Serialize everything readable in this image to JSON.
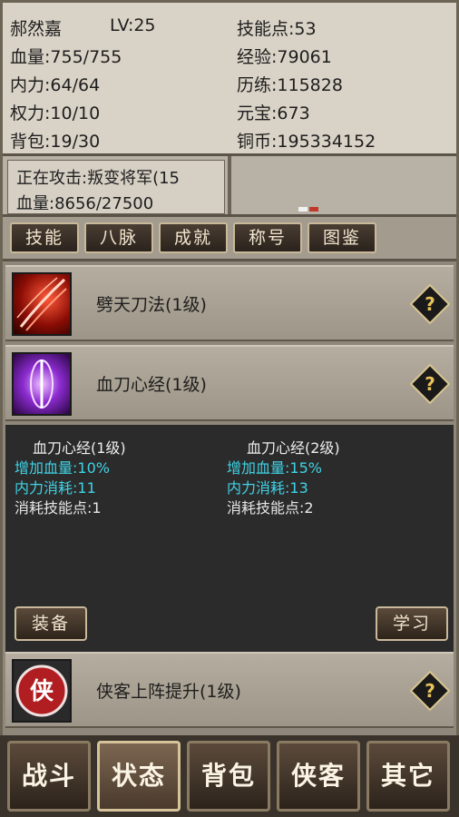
{
  "player": {
    "name": "郝然嘉",
    "level": "LV:25",
    "skill_points": "技能点:53",
    "hp": "血量:755/755",
    "exp": "经验:79061",
    "mp": "内力:64/64",
    "training": "历练:115828",
    "power": "权力:10/10",
    "yuanbao": "元宝:673",
    "bag": "背包:19/30",
    "copper": "铜币:195334152"
  },
  "target": {
    "attacking": "正在攻击:叛变将军(15",
    "hp": "血量:8656/27500"
  },
  "tabs": [
    "技能",
    "八脉",
    "成就",
    "称号",
    "图鉴"
  ],
  "skills": [
    {
      "name": "劈天刀法(1级)",
      "icon": "blade-slash-icon"
    },
    {
      "name": "血刀心经(1级)",
      "icon": "purple-aura-icon"
    },
    {
      "name": "侠客上阵提升(1级)",
      "icon": "xia-emblem-icon",
      "emblem_char": "侠"
    }
  ],
  "detail": {
    "current": {
      "title": "血刀心经(1级)",
      "hp_bonus": "增加血量:10%",
      "mp_cost": "内力消耗:11",
      "sp_cost": "消耗技能点:1"
    },
    "next": {
      "title": "血刀心经(2级)",
      "hp_bonus": "增加血量:15%",
      "mp_cost": "内力消耗:13",
      "sp_cost": "消耗技能点:2"
    },
    "equip_label": "装备",
    "learn_label": "学习"
  },
  "help_label": "?",
  "nav": [
    "战斗",
    "状态",
    "背包",
    "侠客",
    "其它"
  ],
  "active_nav": "状态",
  "colors": {
    "cyan_text": "#3fd3e6",
    "panel_bg": "#d9d2c6",
    "button_border": "#c9b99a"
  }
}
